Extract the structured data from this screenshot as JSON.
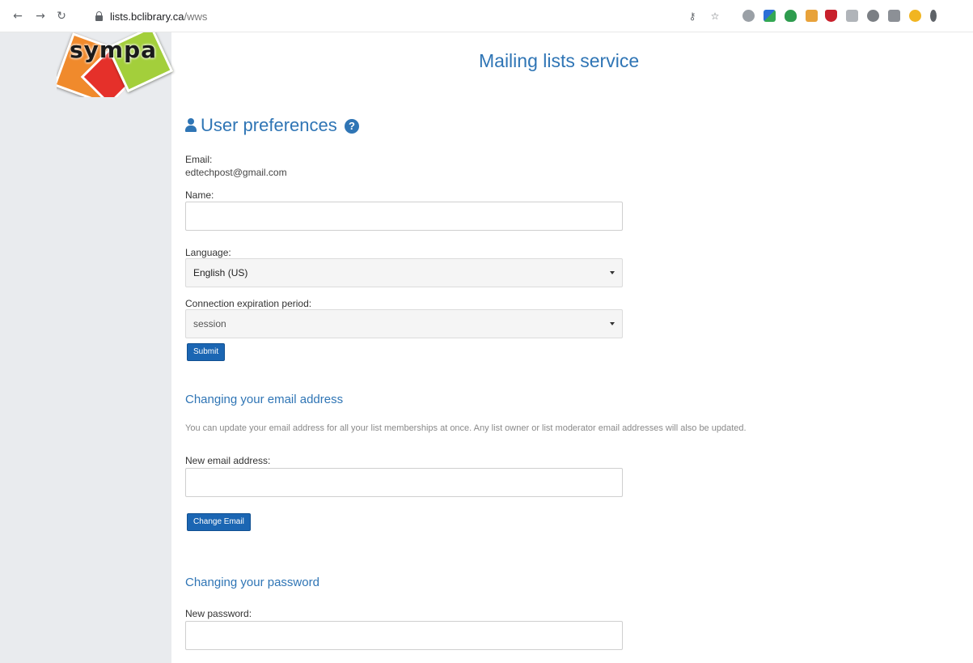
{
  "browser": {
    "url_host": "lists.bclibrary.ca",
    "url_path": "/wws"
  },
  "logo": {
    "text": "sympa"
  },
  "header": {
    "title": "Mailing lists service"
  },
  "preferences": {
    "heading": "User preferences",
    "email_label": "Email:",
    "email_value": "edtechpost@gmail.com",
    "name_label": "Name:",
    "name_value": "",
    "language_label": "Language:",
    "language_value": "English (US)",
    "expiration_label": "Connection expiration period:",
    "expiration_value": "session",
    "submit_label": "Submit"
  },
  "change_email": {
    "heading": "Changing your email address",
    "note": "You can update your email address for all your list memberships at once. Any list owner or list moderator email addresses will also be updated.",
    "new_email_label": "New email address:",
    "new_email_value": "",
    "button_label": "Change Email"
  },
  "change_password": {
    "heading": "Changing your password",
    "new_password_label": "New password:",
    "new_password_value": ""
  },
  "colors": {
    "accent": "#2f75b5",
    "button": "#1b66b3",
    "sidebar": "#e9ebee"
  },
  "icons": {
    "back": "back-arrow-icon",
    "forward": "forward-arrow-icon",
    "reload": "reload-icon",
    "lock": "lock-icon",
    "key": "key-icon",
    "star": "star-icon",
    "user": "user-icon",
    "help": "question-circle-icon"
  }
}
